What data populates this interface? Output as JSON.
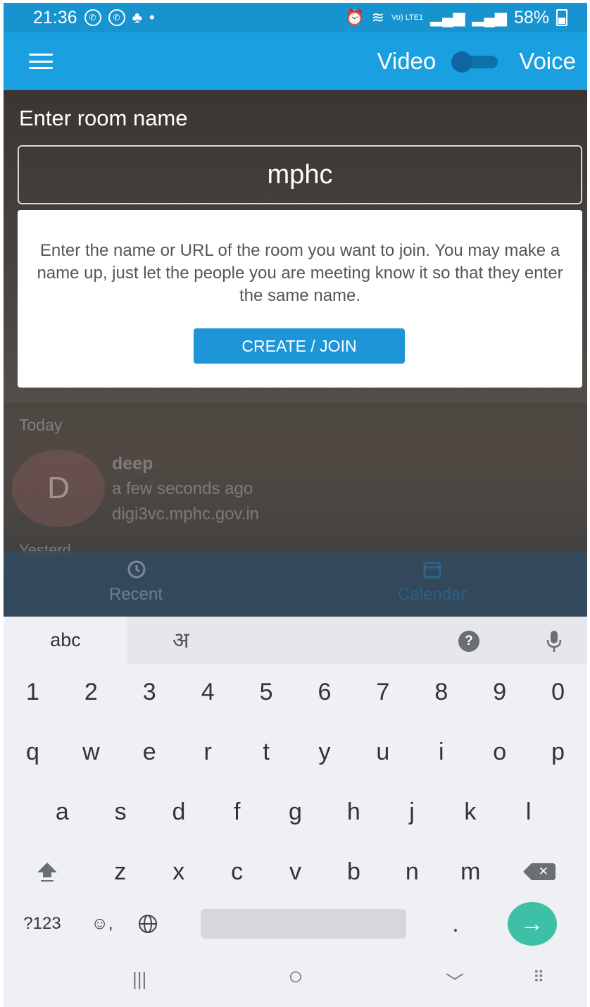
{
  "status_bar": {
    "time": "21:36",
    "network": "Vo) LTE1",
    "battery": "58%"
  },
  "app_bar": {
    "video_label": "Video",
    "voice_label": "Voice"
  },
  "room": {
    "label": "Enter room name",
    "value": "mphc"
  },
  "info_card": {
    "text": "Enter the name or URL of the room you want to join. You may make a name up, just let the people you are meeting know it so that they enter the same name.",
    "button_label": "CREATE / JOIN"
  },
  "recent": {
    "today_label": "Today",
    "item": {
      "initial": "D",
      "name": "deep",
      "time": "a few seconds ago",
      "url": "digi3vc.mphc.gov.in"
    },
    "yesterday_label": "Yesterd..."
  },
  "bottom_nav": {
    "recent_label": "Recent",
    "calendar_label": "Calendar"
  },
  "keyboard": {
    "tab_abc": "abc",
    "tab_hindi": "अ",
    "help_symbol": "?",
    "number_row": [
      "1",
      "2",
      "3",
      "4",
      "5",
      "6",
      "7",
      "8",
      "9",
      "0"
    ],
    "row_q": [
      "q",
      "w",
      "e",
      "r",
      "t",
      "y",
      "u",
      "i",
      "o",
      "p"
    ],
    "row_a": [
      "a",
      "s",
      "d",
      "f",
      "g",
      "h",
      "j",
      "k",
      "l"
    ],
    "row_z": [
      "z",
      "x",
      "c",
      "v",
      "b",
      "n",
      "m"
    ],
    "symbols_key": "?123",
    "emoji_key": "☺,",
    "period_key": ".",
    "enter_symbol": "→"
  },
  "nav_bar": {
    "recents": "|||",
    "home": "○",
    "back": "﹀",
    "keyboard": "⠿"
  },
  "colors": {
    "status_bar": "#1793cf",
    "app_bar": "#1aa0e0",
    "button": "#1d95d6",
    "enter_key": "#3ec0a7"
  }
}
